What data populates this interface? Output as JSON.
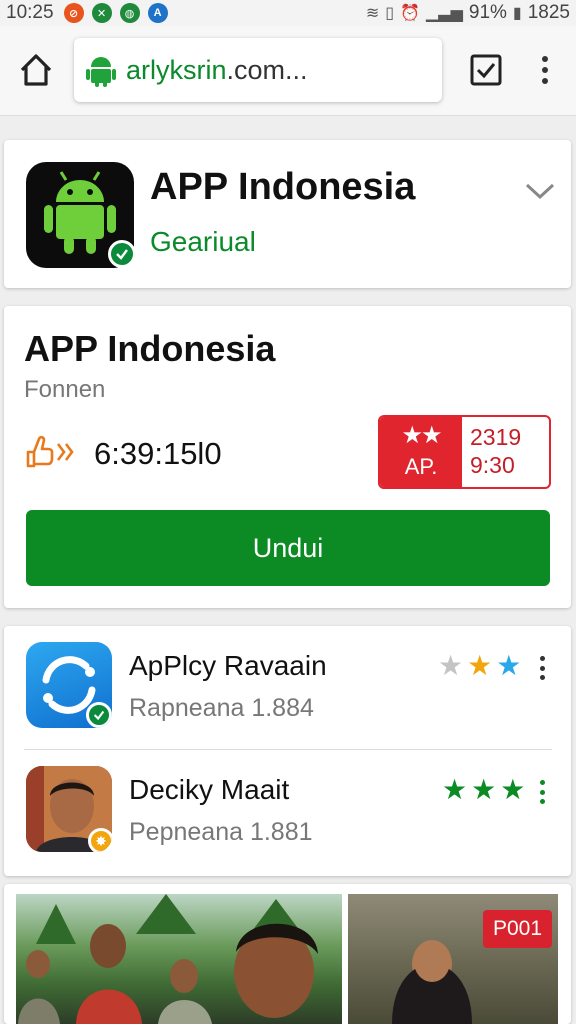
{
  "status_bar": {
    "time": "10:25",
    "battery": "91%",
    "extra": "1825"
  },
  "browser": {
    "url_prefix": "arlyksrin",
    "url_suffix": ".com..."
  },
  "app_header": {
    "title": "APP Indonesia",
    "subtitle": "Geariual"
  },
  "app_detail": {
    "title": "APP Indonesia",
    "subtitle": "Fonnen",
    "time_value": "6:39:15l0",
    "rating_label": "AP.",
    "rating_top": "2319",
    "rating_bottom": "9:30",
    "download_label": "Undui"
  },
  "related_apps": [
    {
      "name": "ApPlcy Ravaain",
      "sub": "Rapneana 1.884",
      "stars": [
        "gray",
        "gold",
        "blue"
      ]
    },
    {
      "name": "Deciky Maait",
      "sub": "Pepneana 1.881",
      "stars": [
        "green",
        "green",
        "green"
      ]
    }
  ],
  "photo_badge": "P001",
  "colors": {
    "brand_green": "#0c8a23",
    "accent_red": "#e0252f"
  }
}
